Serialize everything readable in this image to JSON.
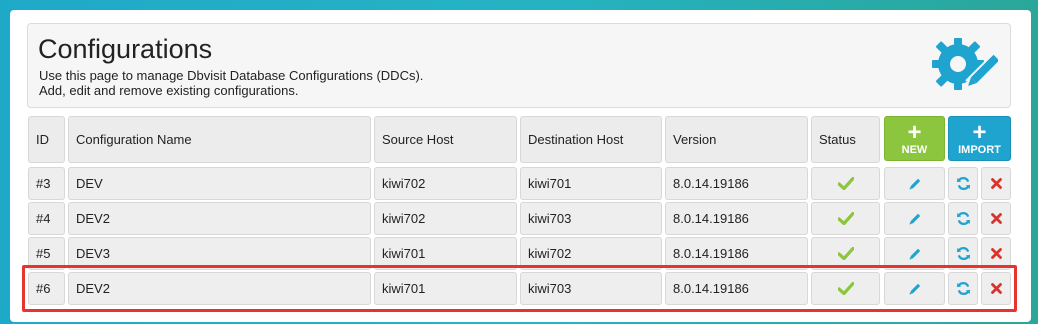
{
  "header": {
    "title": "Configurations",
    "description_line1": "Use this page to manage Dbvisit Database Configurations (DDCs).",
    "description_line2": "Add, edit and remove existing configurations."
  },
  "table": {
    "columns": {
      "id": "ID",
      "name": "Configuration Name",
      "source": "Source Host",
      "destination": "Destination Host",
      "version": "Version",
      "status": "Status"
    },
    "actions": {
      "new_label": "NEW",
      "import_label": "IMPORT"
    },
    "rows": [
      {
        "id": "#3",
        "name": "DEV",
        "source": "kiwi702",
        "destination": "kiwi701",
        "version": "8.0.14.19186"
      },
      {
        "id": "#4",
        "name": "DEV2",
        "source": "kiwi702",
        "destination": "kiwi703",
        "version": "8.0.14.19186"
      },
      {
        "id": "#5",
        "name": "DEV3",
        "source": "kiwi701",
        "destination": "kiwi702",
        "version": "8.0.14.19186"
      },
      {
        "id": "#6",
        "name": "DEV2",
        "source": "kiwi701",
        "destination": "kiwi703",
        "version": "8.0.14.19186"
      }
    ]
  },
  "colors": {
    "accent_blue": "#1fa3cf",
    "accent_green": "#8cc63f",
    "status_ok": "#8cc63f",
    "delete_red": "#d9342a",
    "highlight_red": "#e8342f"
  },
  "icons": {
    "header": "gear-pencil-icon",
    "status": "check-icon",
    "edit": "pencil-icon",
    "sync": "refresh-icon",
    "delete": "close-icon"
  }
}
